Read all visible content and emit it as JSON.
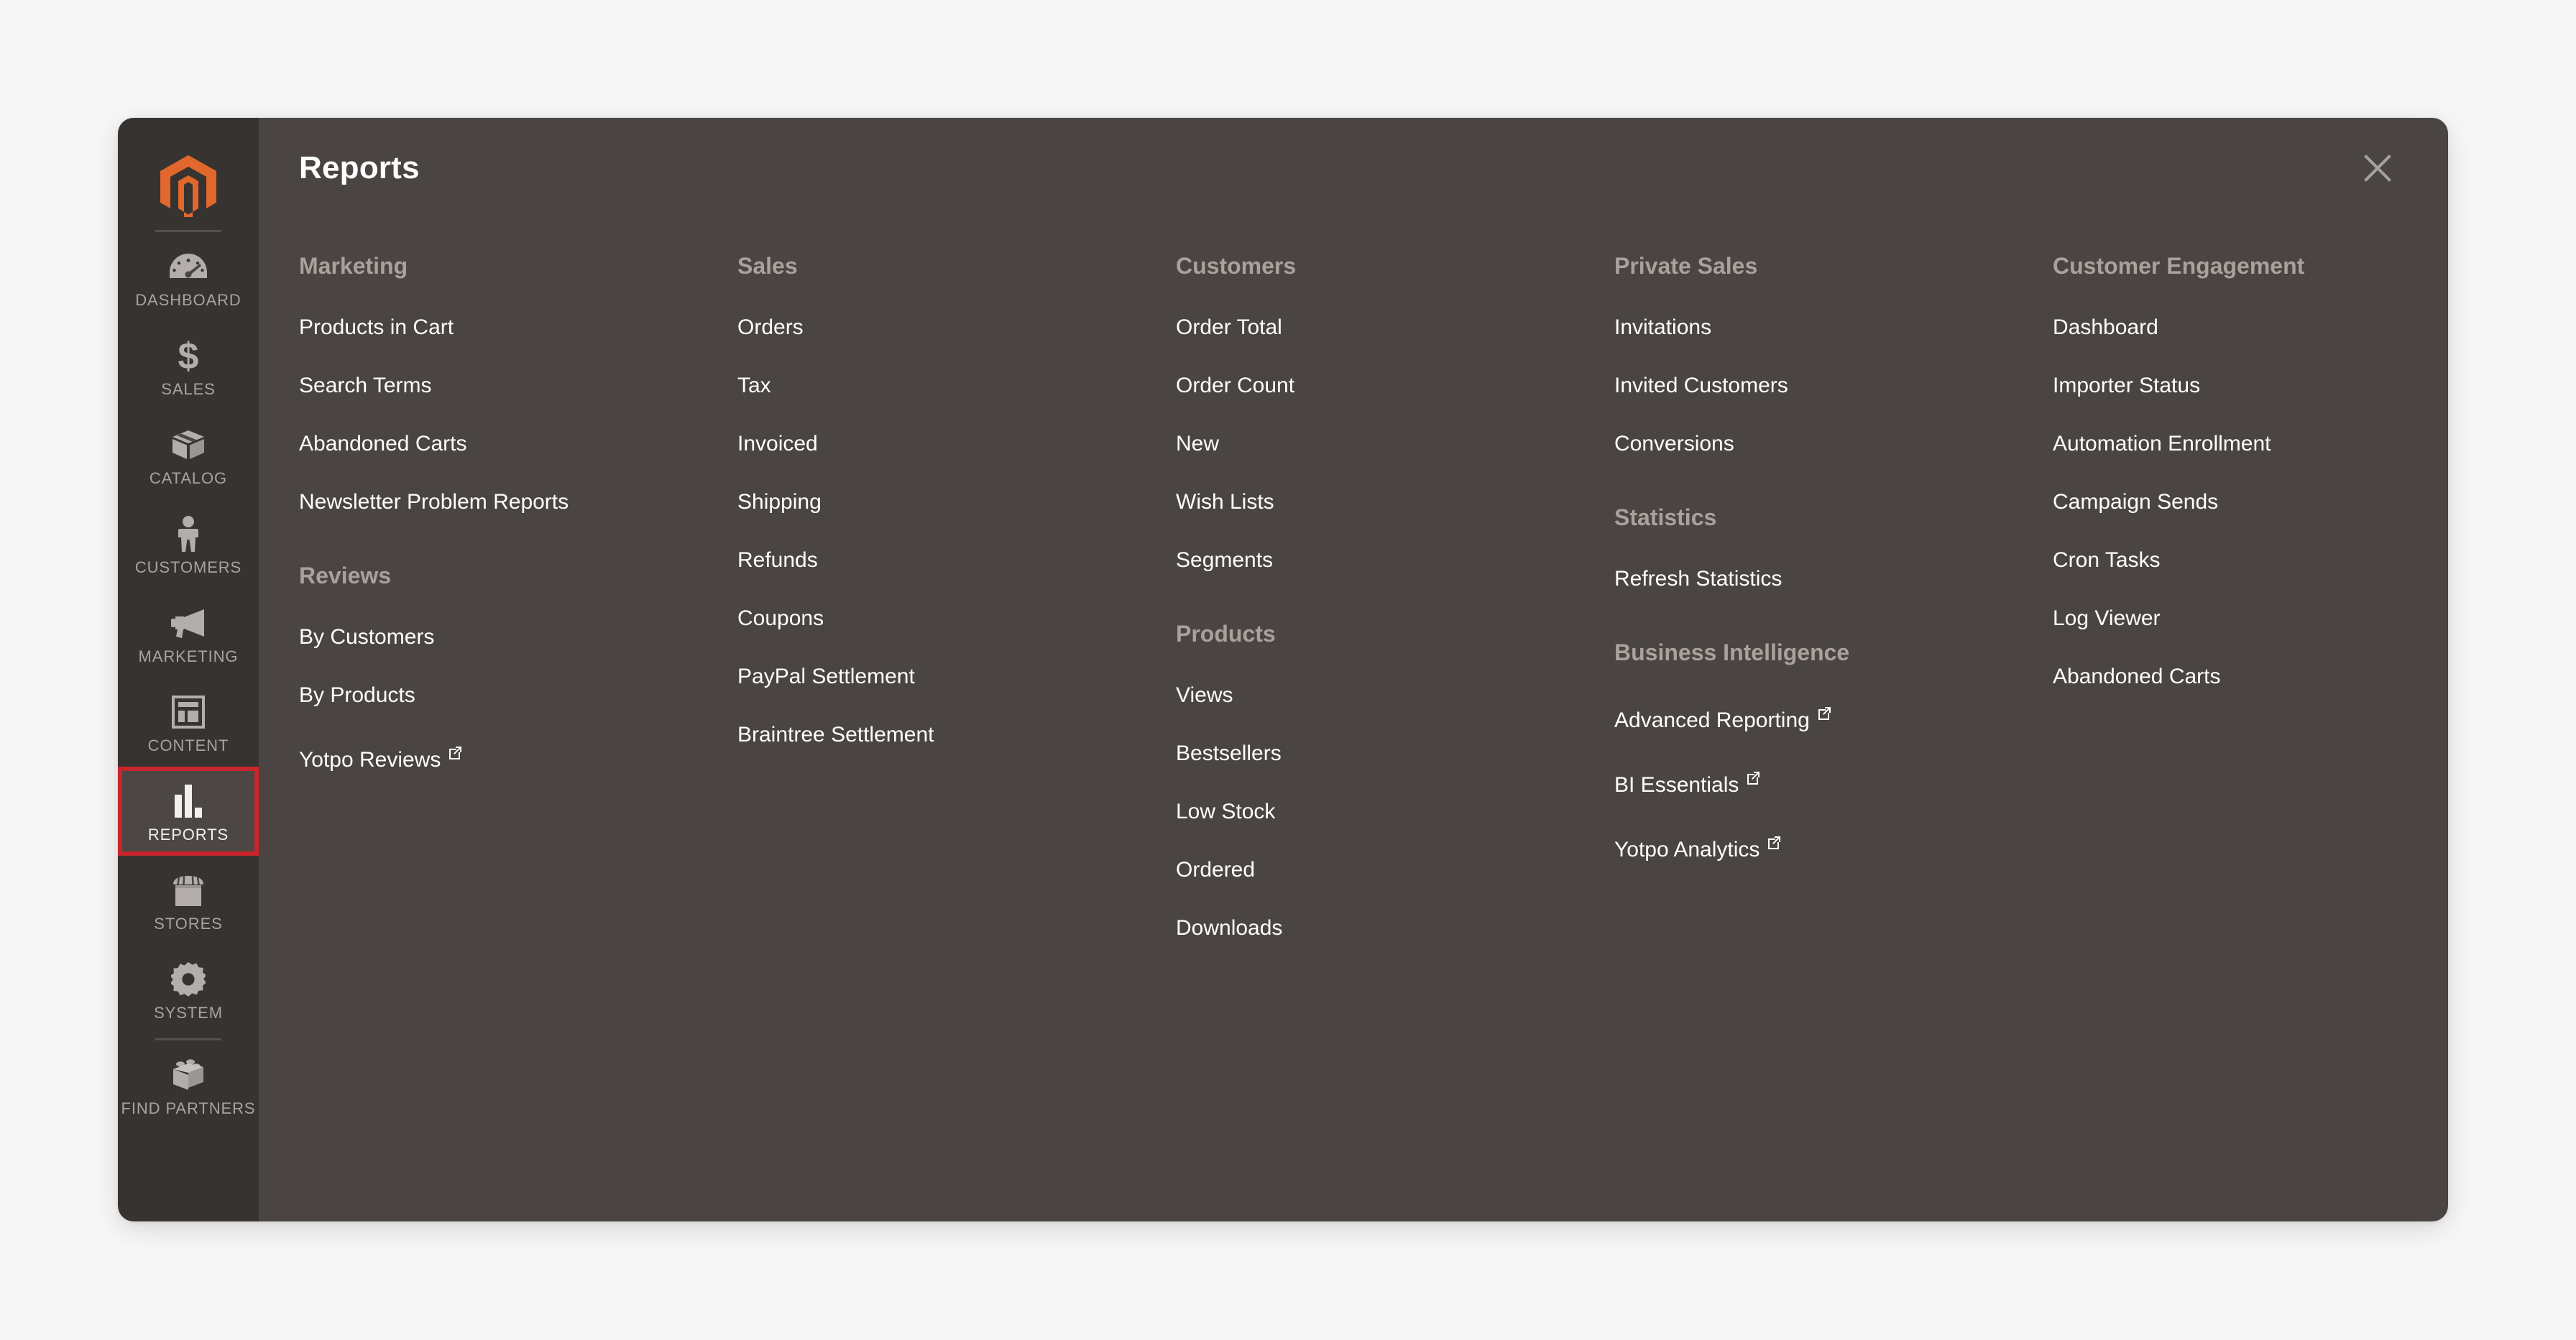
{
  "panel": {
    "title": "Reports",
    "close_icon": "close-icon"
  },
  "sidebar": {
    "logo": "magento-logo",
    "items": [
      {
        "label": "DASHBOARD",
        "icon": "dashboard-gauge-icon",
        "active": false
      },
      {
        "label": "SALES",
        "icon": "dollar-sign-icon",
        "active": false
      },
      {
        "label": "CATALOG",
        "icon": "box-icon",
        "active": false
      },
      {
        "label": "CUSTOMERS",
        "icon": "person-icon",
        "active": false
      },
      {
        "label": "MARKETING",
        "icon": "megaphone-icon",
        "active": false
      },
      {
        "label": "CONTENT",
        "icon": "layout-icon",
        "active": false
      },
      {
        "label": "REPORTS",
        "icon": "bar-chart-icon",
        "active": true
      },
      {
        "label": "STORES",
        "icon": "storefront-icon",
        "active": false
      },
      {
        "label": "SYSTEM",
        "icon": "gear-icon",
        "active": false
      },
      {
        "label": "FIND PARTNERS",
        "icon": "lego-brick-icon",
        "active": false
      }
    ]
  },
  "columns": [
    {
      "groups": [
        {
          "title": "Marketing",
          "links": [
            {
              "label": "Products in Cart",
              "external": false
            },
            {
              "label": "Search Terms",
              "external": false
            },
            {
              "label": "Abandoned Carts",
              "external": false
            },
            {
              "label": "Newsletter Problem Reports",
              "external": false
            }
          ]
        },
        {
          "title": "Reviews",
          "links": [
            {
              "label": "By Customers",
              "external": false
            },
            {
              "label": "By Products",
              "external": false
            },
            {
              "label": "Yotpo Reviews",
              "external": true
            }
          ]
        }
      ]
    },
    {
      "groups": [
        {
          "title": "Sales",
          "links": [
            {
              "label": "Orders",
              "external": false
            },
            {
              "label": "Tax",
              "external": false
            },
            {
              "label": "Invoiced",
              "external": false
            },
            {
              "label": "Shipping",
              "external": false
            },
            {
              "label": "Refunds",
              "external": false
            },
            {
              "label": "Coupons",
              "external": false
            },
            {
              "label": "PayPal Settlement",
              "external": false
            },
            {
              "label": "Braintree Settlement",
              "external": false
            }
          ]
        }
      ]
    },
    {
      "groups": [
        {
          "title": "Customers",
          "links": [
            {
              "label": "Order Total",
              "external": false
            },
            {
              "label": "Order Count",
              "external": false
            },
            {
              "label": "New",
              "external": false
            },
            {
              "label": "Wish Lists",
              "external": false
            },
            {
              "label": "Segments",
              "external": false
            }
          ]
        },
        {
          "title": "Products",
          "links": [
            {
              "label": "Views",
              "external": false
            },
            {
              "label": "Bestsellers",
              "external": false
            },
            {
              "label": "Low Stock",
              "external": false
            },
            {
              "label": "Ordered",
              "external": false
            },
            {
              "label": "Downloads",
              "external": false
            }
          ]
        }
      ]
    },
    {
      "groups": [
        {
          "title": "Private Sales",
          "links": [
            {
              "label": "Invitations",
              "external": false
            },
            {
              "label": "Invited Customers",
              "external": false
            },
            {
              "label": "Conversions",
              "external": false
            }
          ]
        },
        {
          "title": "Statistics",
          "links": [
            {
              "label": "Refresh Statistics",
              "external": false
            }
          ]
        },
        {
          "title": "Business Intelligence",
          "links": [
            {
              "label": "Advanced Reporting",
              "external": true
            },
            {
              "label": "BI Essentials",
              "external": true
            },
            {
              "label": "Yotpo Analytics",
              "external": true
            }
          ]
        }
      ]
    },
    {
      "groups": [
        {
          "title": "Customer Engagement",
          "links": [
            {
              "label": "Dashboard",
              "external": false
            },
            {
              "label": "Importer Status",
              "external": false
            },
            {
              "label": "Automation Enrollment",
              "external": false
            },
            {
              "label": "Campaign Sends",
              "external": false
            },
            {
              "label": "Cron Tasks",
              "external": false
            },
            {
              "label": "Log Viewer",
              "external": false
            },
            {
              "label": "Abandoned Carts",
              "external": false
            }
          ]
        }
      ]
    }
  ],
  "colors": {
    "rail_bg": "#373330",
    "panel_bg": "#4a4542",
    "accent_orange": "#e1672c",
    "active_outline": "#c9252c",
    "group_title": "#a8a19c",
    "link_text": "#ffffff",
    "page_bg": "#f7f7f7"
  }
}
